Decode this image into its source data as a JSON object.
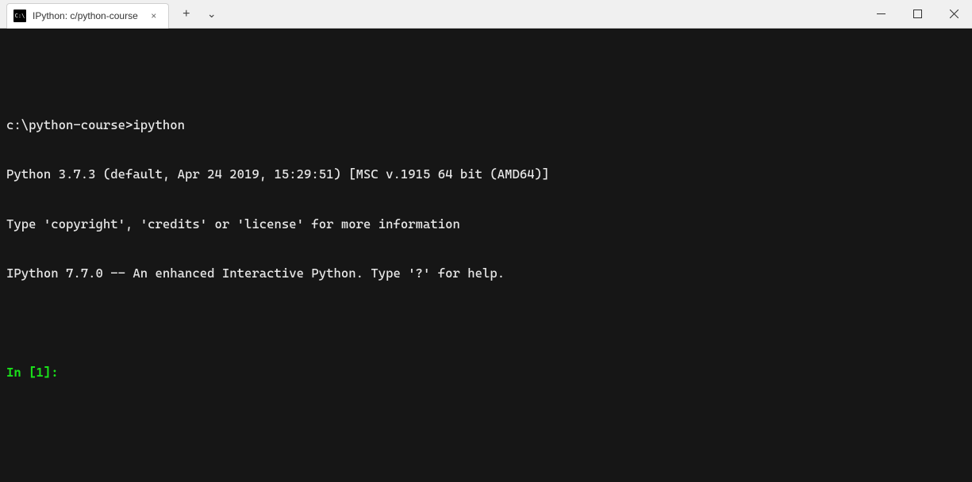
{
  "titlebar": {
    "tab": {
      "icon_text": "C:\\",
      "title": "IPython: c/python-course",
      "close_symbol": "×"
    },
    "new_tab_symbol": "+",
    "dropdown_symbol": "⌄"
  },
  "terminal": {
    "command_line": "c:\\python-course>ipython",
    "python_version_line": "Python 3.7.3 (default, Apr 24 2019, 15:29:51) [MSC v.1915 64 bit (AMD64)]",
    "info_line": "Type 'copyright', 'credits' or 'license' for more information",
    "ipython_line": "IPython 7.7.0 -- An enhanced Interactive Python. Type '?' for help.",
    "prompt": "In [1]: "
  }
}
